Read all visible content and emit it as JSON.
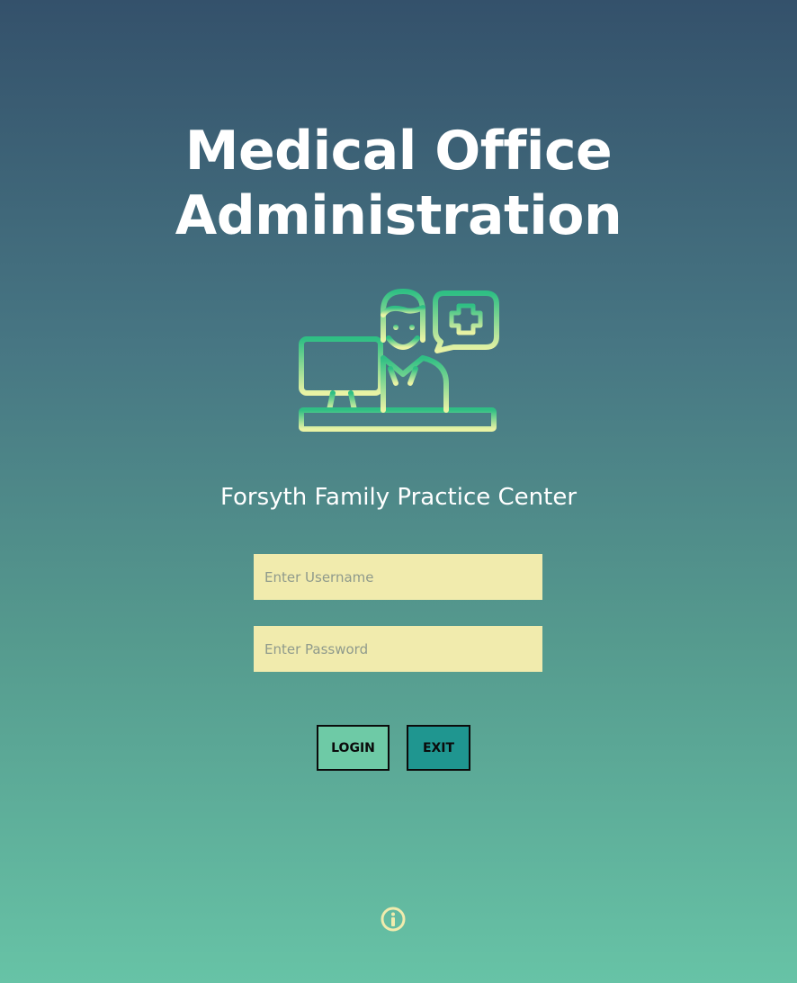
{
  "app": {
    "title_line1": "Medical Office",
    "title_line2": "Administration",
    "practice_name": "Forsyth Family Practice Center"
  },
  "hero": {
    "icon": "doctor-at-computer-icon"
  },
  "login_form": {
    "username_placeholder": "Enter Username",
    "username_value": "",
    "password_placeholder": "Enter Password",
    "password_value": "",
    "login_label": "LOGIN",
    "exit_label": "EXIT"
  },
  "footer": {
    "info_icon": "info-icon"
  },
  "colors": {
    "background_top": "#34516b",
    "background_bottom": "#67c3a6",
    "field_background": "#f1ebad",
    "login_button": "#6ecaa6",
    "exit_button": "#1f9690",
    "icon_gradient_top": "#2fbf84",
    "icon_gradient_bottom": "#e9f3a4"
  }
}
